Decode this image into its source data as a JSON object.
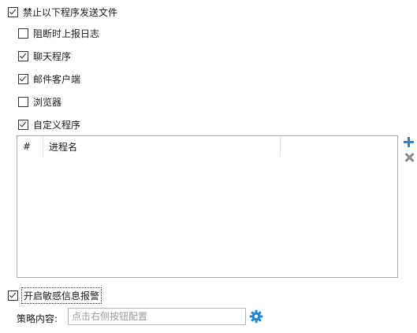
{
  "block_sending": {
    "label": "禁止以下程序发送文件",
    "checked": true
  },
  "options": [
    {
      "label": "阻断时上报日志",
      "checked": false
    },
    {
      "label": "聊天程序",
      "checked": true
    },
    {
      "label": "邮件客户端",
      "checked": true
    },
    {
      "label": "浏览器",
      "checked": false
    },
    {
      "label": "自定义程序",
      "checked": true
    }
  ],
  "process_list": {
    "columns": [
      "#",
      "进程名",
      ""
    ],
    "rows": []
  },
  "icons": {
    "add": "plus-icon",
    "remove": "close-icon",
    "settings": "gear-icon"
  },
  "sensitive_alert": {
    "label": "开启敏感信息报警",
    "checked": true
  },
  "policy": {
    "label": "策略内容:",
    "placeholder": "点击右侧按钮配置"
  },
  "colors": {
    "accent": "#1e88d6",
    "remove_gray": "#8c8c8c"
  }
}
